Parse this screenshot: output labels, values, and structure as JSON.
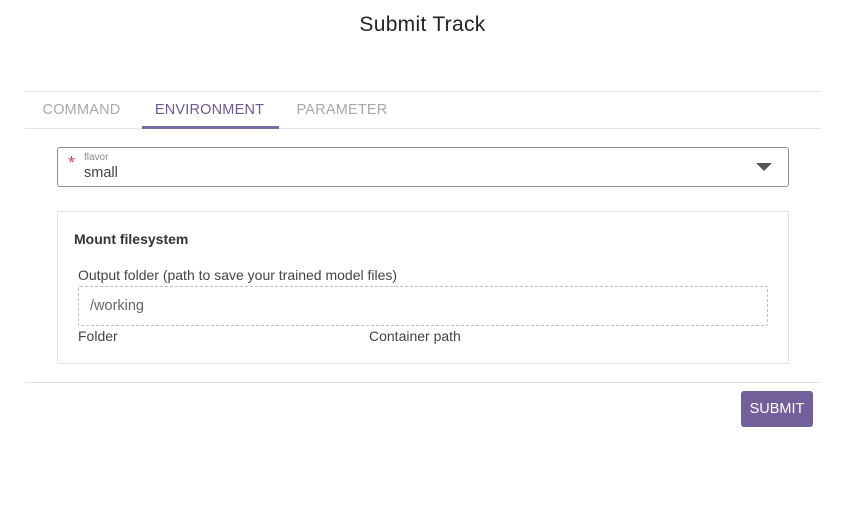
{
  "dialog": {
    "title": "Submit Track"
  },
  "tabs": [
    {
      "label": "COMMAND",
      "active": false
    },
    {
      "label": "ENVIRONMENT",
      "active": true
    },
    {
      "label": "PARAMETER",
      "active": false
    }
  ],
  "flavor": {
    "required_mark": "*",
    "label": "flavor",
    "value": "small",
    "caret_icon": "chevron-down-icon"
  },
  "mount": {
    "title": "Mount filesystem",
    "output_label": "Output folder (path to save your trained model files)",
    "output_value": "/working",
    "folder_hint": "Folder",
    "container_hint": "Container path"
  },
  "actions": {
    "submit_label": "SUBMIT"
  },
  "colors": {
    "accent": "#71609a",
    "tab_active": "#6b5a94",
    "tab_inactive": "#a8a8a8",
    "required": "#e0435a"
  }
}
